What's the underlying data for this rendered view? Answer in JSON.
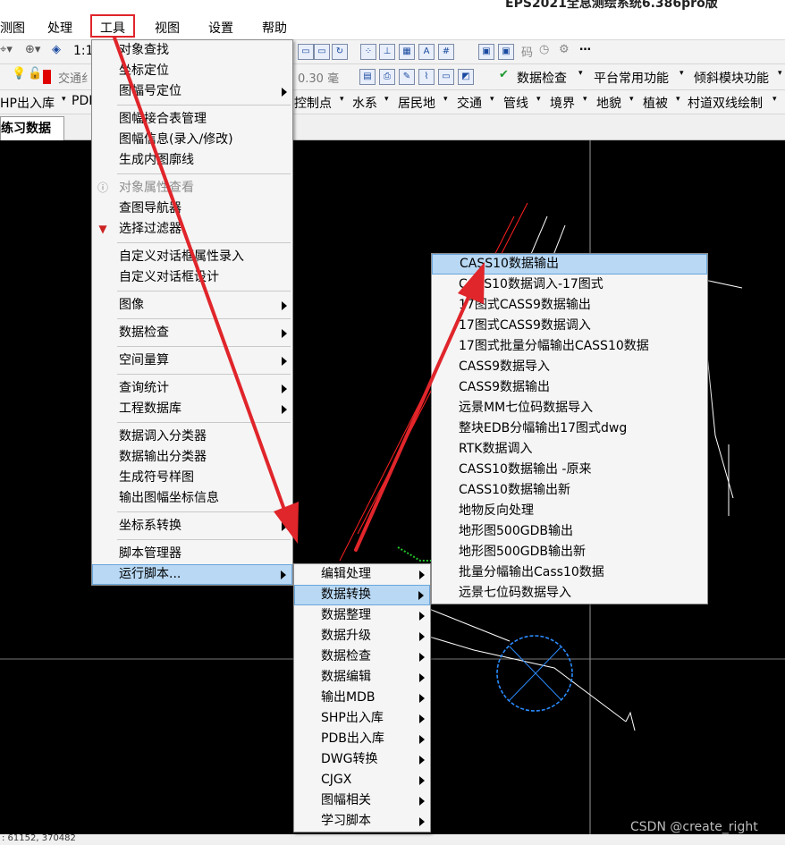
{
  "window_title": "EPS2021全息测绘系统6.386pro版",
  "menubar": {
    "items": [
      "测图",
      "处理",
      "工具",
      "视图",
      "设置",
      "帮助"
    ],
    "selected": "工具"
  },
  "toolbar1": {
    "scale_fragment": "1:1"
  },
  "toolbar2": {
    "layer_fragment": "交通纟",
    "line_width": "0.30 毫",
    "data_check_btn": "数据检查",
    "platform_btn": "平台常用功能",
    "oblique_btn": "倾斜模块功能"
  },
  "toolbar3": {
    "items": [
      "HP出入库",
      "PDE",
      "控制点",
      "水系",
      "居民地",
      "交通",
      "管线",
      "境界",
      "地貌",
      "植被",
      "村道双线绘制"
    ]
  },
  "tab": {
    "label": "练习数据"
  },
  "tools_menu": {
    "items": [
      {
        "label": "对象查找"
      },
      {
        "label": "坐标定位"
      },
      {
        "label": "图幅号定位",
        "submenu": true
      },
      {
        "label": "图幅接合表管理"
      },
      {
        "label": "图幅信息(录入/修改)"
      },
      {
        "label": "生成内图廓线"
      },
      {
        "label": "对象属性查看",
        "disabled": true
      },
      {
        "label": "查图导航器"
      },
      {
        "label": "选择过滤器"
      },
      {
        "label": "自定义对话框属性录入"
      },
      {
        "label": "自定义对话框设计"
      },
      {
        "label": "图像",
        "submenu": true
      },
      {
        "label": "数据检查",
        "submenu": true
      },
      {
        "label": "空间量算",
        "submenu": true
      },
      {
        "label": "查询统计",
        "submenu": true
      },
      {
        "label": "工程数据库",
        "submenu": true
      },
      {
        "label": "数据调入分类器"
      },
      {
        "label": "数据输出分类器"
      },
      {
        "label": "生成符号样图"
      },
      {
        "label": "输出图幅坐标信息"
      },
      {
        "label": "坐标系转换",
        "submenu": true
      },
      {
        "label": "脚本管理器"
      },
      {
        "label": "运行脚本...",
        "submenu": true,
        "highlighted": true
      }
    ]
  },
  "script_menu": {
    "items": [
      {
        "label": "编辑处理"
      },
      {
        "label": "数据转换",
        "highlighted": true
      },
      {
        "label": "数据整理"
      },
      {
        "label": "数据升级"
      },
      {
        "label": "数据检查"
      },
      {
        "label": "数据编辑"
      },
      {
        "label": "输出MDB"
      },
      {
        "label": "SHP出入库"
      },
      {
        "label": "PDB出入库"
      },
      {
        "label": "DWG转换"
      },
      {
        "label": "CJGX"
      },
      {
        "label": "图幅相关"
      },
      {
        "label": "学习脚本"
      }
    ]
  },
  "convert_menu": {
    "items": [
      {
        "label": "CASS10数据输出",
        "highlighted": true
      },
      {
        "label": "CASS10数据调入-17图式"
      },
      {
        "label": "17图式CASS9数据输出"
      },
      {
        "label": "17图式CASS9数据调入"
      },
      {
        "label": "17图式批量分幅输出CASS10数据"
      },
      {
        "label": "CASS9数据导入"
      },
      {
        "label": "CASS9数据输出"
      },
      {
        "label": "远景MM七位码数据导入"
      },
      {
        "label": "整块EDB分幅输出17图式dwg"
      },
      {
        "label": "RTK数据调入"
      },
      {
        "label": "CASS10数据输出 -原来"
      },
      {
        "label": "CASS10数据输出新"
      },
      {
        "label": "地物反向处理"
      },
      {
        "label": "地形图500GDB输出"
      },
      {
        "label": "地形图500GDB输出新"
      },
      {
        "label": "批量分幅输出Cass10数据"
      },
      {
        "label": "远景七位码数据导入"
      }
    ]
  },
  "status": {
    "coords": ": 61152, 370482"
  },
  "watermark": "CSDN @create_right",
  "colors": {
    "annotation_red": "#e0252b",
    "menu_highlight": "#b8d8f4",
    "canvas_bg": "#000000"
  }
}
